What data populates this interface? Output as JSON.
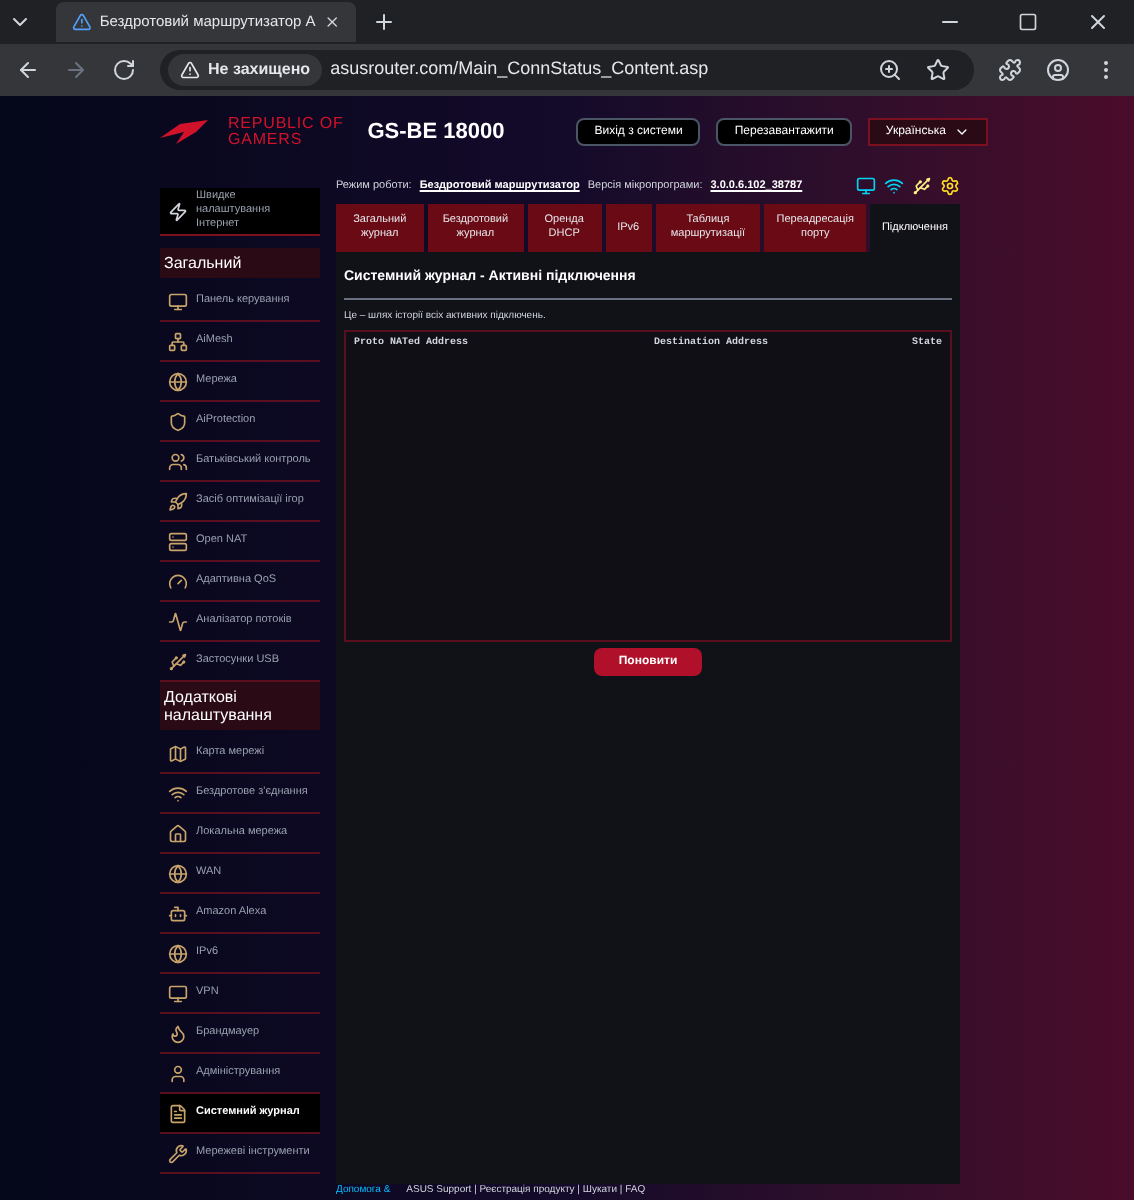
{
  "browser": {
    "tab_title": "Бездротовий маршрутизатор А",
    "security": "Не захищено",
    "url": "asusrouter.com/Main_ConnStatus_Content.asp"
  },
  "header": {
    "logo_line1": "REPUBLIC OF",
    "logo_line2": "GAMERS",
    "model": "GS-BE 18000",
    "buttons": [
      "Вихід з системи",
      "Перезавантажити"
    ],
    "language": "Українська"
  },
  "status": {
    "mode_label": "Режим роботи:",
    "mode": "Бездротовий маршрутизатор",
    "firmware_label": "Версія мікропрограми:",
    "firmware": "3.0.0.6.102_38787"
  },
  "sidebar": {
    "quick": "Швидке налаштування Інтернет",
    "sections": [
      {
        "title": "Загальний",
        "items": [
          {
            "label": "Панель керування",
            "selected": false
          },
          {
            "label": "AiMesh",
            "selected": false
          },
          {
            "label": "Мережа",
            "selected": false
          },
          {
            "label": "AiProtection",
            "selected": false
          },
          {
            "label": "Батьківський контроль",
            "selected": false
          },
          {
            "label": "Засіб оптимізації ігор",
            "selected": false
          },
          {
            "label": "Open NAT",
            "selected": false
          },
          {
            "label": "Адаптивна QoS",
            "selected": false
          },
          {
            "label": "Аналізатор потоків",
            "selected": false
          },
          {
            "label": "Застосунки USB",
            "selected": false
          }
        ]
      },
      {
        "title": "Додаткові налаштування",
        "items": [
          {
            "label": "Карта мережі",
            "selected": false
          },
          {
            "label": "Бездротове з'єднання",
            "selected": false
          },
          {
            "label": "Локальна мережа",
            "selected": false
          },
          {
            "label": "WAN",
            "selected": false
          },
          {
            "label": "Amazon Alexa",
            "selected": false
          },
          {
            "label": "IPv6",
            "selected": false
          },
          {
            "label": "VPN",
            "selected": false
          },
          {
            "label": "Брандмауер",
            "selected": false
          },
          {
            "label": "Адміністрування",
            "selected": false
          },
          {
            "label": "Системний журнал",
            "selected": true
          },
          {
            "label": "Мережеві інструменти",
            "selected": false
          }
        ]
      }
    ]
  },
  "tabs": [
    {
      "label": "Загальний журнал",
      "selected": false
    },
    {
      "label": "Бездротовий журнал",
      "selected": false
    },
    {
      "label": "Оренда DHCP",
      "selected": false
    },
    {
      "label": "IPv6",
      "selected": false
    },
    {
      "label": "Таблиця маршрутизації",
      "selected": false
    },
    {
      "label": "Переадресація порту",
      "selected": false
    },
    {
      "label": "Підключення",
      "selected": true
    }
  ],
  "panel": {
    "title": "Системний журнал - Активні підключення",
    "description": "Це – шлях історії всіх активних підключень.",
    "columns": [
      "Proto NATed Address",
      "Destination Address",
      "State"
    ],
    "refresh_button": "Поновити"
  },
  "footer": {
    "help": "Допомога &",
    "links": "ASUS Support | Реєстрація продукту | Шукати | FAQ"
  }
}
